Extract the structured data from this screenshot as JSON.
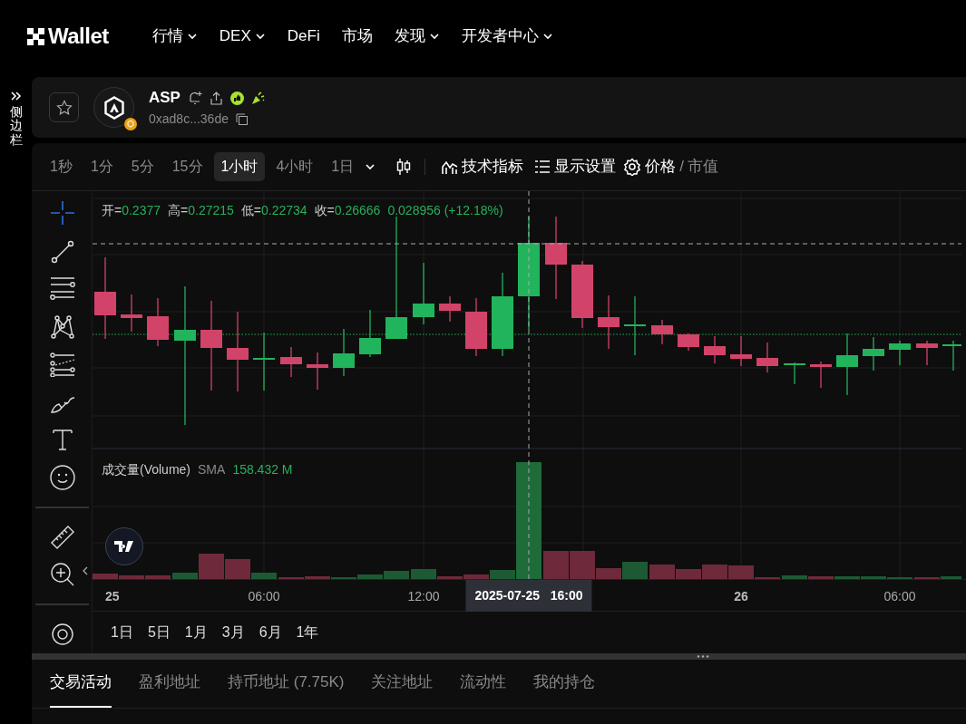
{
  "header": {
    "brand": "Wallet",
    "nav": [
      {
        "label": "行情",
        "dropdown": true
      },
      {
        "label": "DEX",
        "dropdown": true
      },
      {
        "label": "DeFi",
        "dropdown": false
      },
      {
        "label": "市场",
        "dropdown": false
      },
      {
        "label": "发现",
        "dropdown": true
      },
      {
        "label": "开发者中心",
        "dropdown": true
      }
    ]
  },
  "sidebar_toggle": {
    "label": "侧边栏"
  },
  "token": {
    "name": "ASP",
    "address": "0xad8c...36de"
  },
  "toolbar": {
    "intervals": [
      {
        "label": "1秒",
        "selected": false
      },
      {
        "label": "1分",
        "selected": false
      },
      {
        "label": "5分",
        "selected": false
      },
      {
        "label": "15分",
        "selected": false
      },
      {
        "label": "1小时",
        "selected": true
      },
      {
        "label": "4小时",
        "selected": false
      },
      {
        "label": "1日",
        "selected": false
      }
    ],
    "indicators": "技术指标",
    "display_settings": "显示设置",
    "mode_options": [
      {
        "label": "价格",
        "selected": true
      },
      {
        "label": "市值",
        "selected": false
      }
    ],
    "mode_separator": "/"
  },
  "tools": [
    {
      "kind": "crosshair",
      "selected": true
    },
    {
      "kind": "trendline",
      "selected": false
    },
    {
      "kind": "hlines",
      "selected": false
    },
    {
      "kind": "pattern",
      "selected": false
    },
    {
      "kind": "fib",
      "selected": false
    },
    {
      "kind": "brush",
      "selected": false
    },
    {
      "kind": "text",
      "selected": false
    },
    {
      "kind": "emoji",
      "selected": false
    },
    {
      "kind": "divider"
    },
    {
      "kind": "ruler",
      "selected": false
    },
    {
      "kind": "zoom",
      "selected": false
    },
    {
      "kind": "divider"
    },
    {
      "kind": "magnet",
      "selected": false
    }
  ],
  "legend": {
    "ohlc": [
      {
        "label": "开=",
        "value": "0.2377"
      },
      {
        "label": "高=",
        "value": "0.27215"
      },
      {
        "label": "低=",
        "value": "0.22734"
      },
      {
        "label": "收=",
        "value": "0.26666"
      }
    ],
    "change": "0.028956 (+12.18%)"
  },
  "volume_legend": {
    "title": "成交量(Volume)",
    "indicator": "SMA",
    "value": "158.432 M"
  },
  "time_axis": [
    {
      "label": "25",
      "kind": "day"
    },
    {
      "label": "06:00",
      "kind": "time"
    },
    {
      "label": "12:00",
      "kind": "time"
    },
    {
      "label": "2025-07-25   16:00",
      "kind": "crosshair"
    },
    {
      "label": "26",
      "kind": "day"
    },
    {
      "label": "06:00",
      "kind": "time"
    }
  ],
  "ranges": [
    "1日",
    "5日",
    "1月",
    "3月",
    "6月",
    "1年"
  ],
  "bottom_tabs": [
    {
      "label": "交易活动",
      "selected": true
    },
    {
      "label": "盈利地址",
      "selected": false
    },
    {
      "label": "持币地址 (7.75K)",
      "selected": false
    },
    {
      "label": "关注地址",
      "selected": false
    },
    {
      "label": "流动性",
      "selected": false
    },
    {
      "label": "我的持仓",
      "selected": false
    }
  ]
}
